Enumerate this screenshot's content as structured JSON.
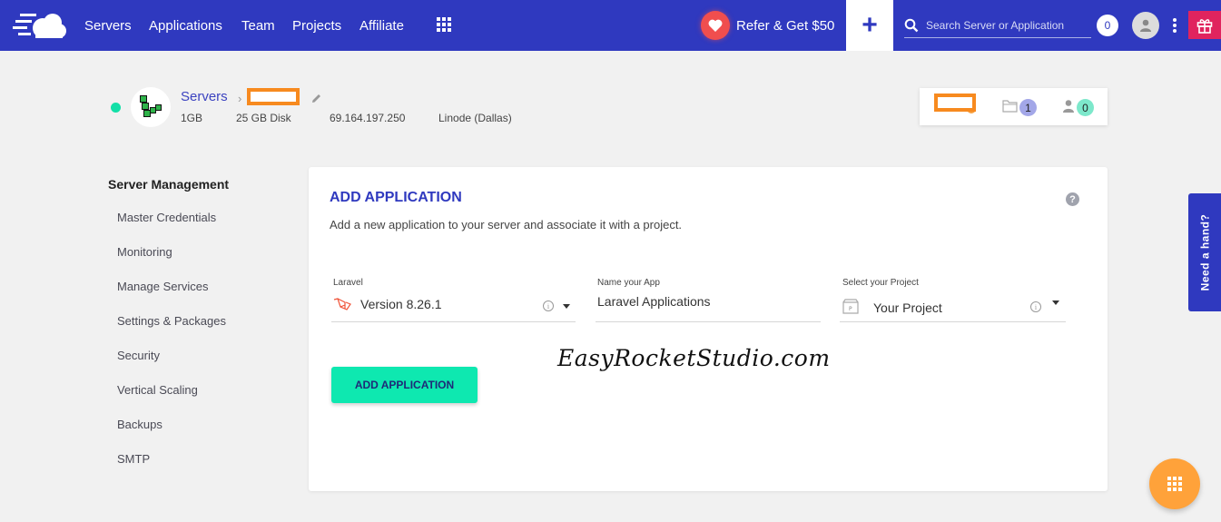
{
  "nav": {
    "links": [
      "Servers",
      "Applications",
      "Team",
      "Projects",
      "Affiliate"
    ],
    "refer_label": "Refer & Get $50",
    "add_symbol": "+",
    "search_placeholder": "Search Server or Application",
    "notification_count": "0",
    "colors": {
      "bar": "#2f39bf",
      "refer": "#f04e4e",
      "gift": "#e0245e"
    }
  },
  "server": {
    "breadcrumb_root": "Servers",
    "breadcrumb_sep": "›",
    "memory": "1GB",
    "disk": "25 GB Disk",
    "ip": "69.164.197.250",
    "provider": "Linode (Dallas)",
    "status_color": "#13dfa7",
    "stats": {
      "projects_count": "1",
      "members_count": "0"
    }
  },
  "sidebar": {
    "title": "Server Management",
    "items": [
      "Master Credentials",
      "Monitoring",
      "Manage Services",
      "Settings & Packages",
      "Security",
      "Vertical Scaling",
      "Backups",
      "SMTP"
    ]
  },
  "card": {
    "title": "ADD APPLICATION",
    "help_symbol": "?",
    "description": "Add a new application to your server and associate it with a project.",
    "fields": {
      "application": {
        "label": "Laravel",
        "value": "Version 8.26.1"
      },
      "app_name": {
        "label": "Name your App",
        "value": "Laravel Applications"
      },
      "project": {
        "label": "Select your Project",
        "value": "Your Project"
      }
    },
    "info_symbol": "i",
    "submit_label": "ADD APPLICATION",
    "watermark": "EasyRocketStudio.com"
  },
  "help_tab": {
    "label": "Need a hand?"
  }
}
